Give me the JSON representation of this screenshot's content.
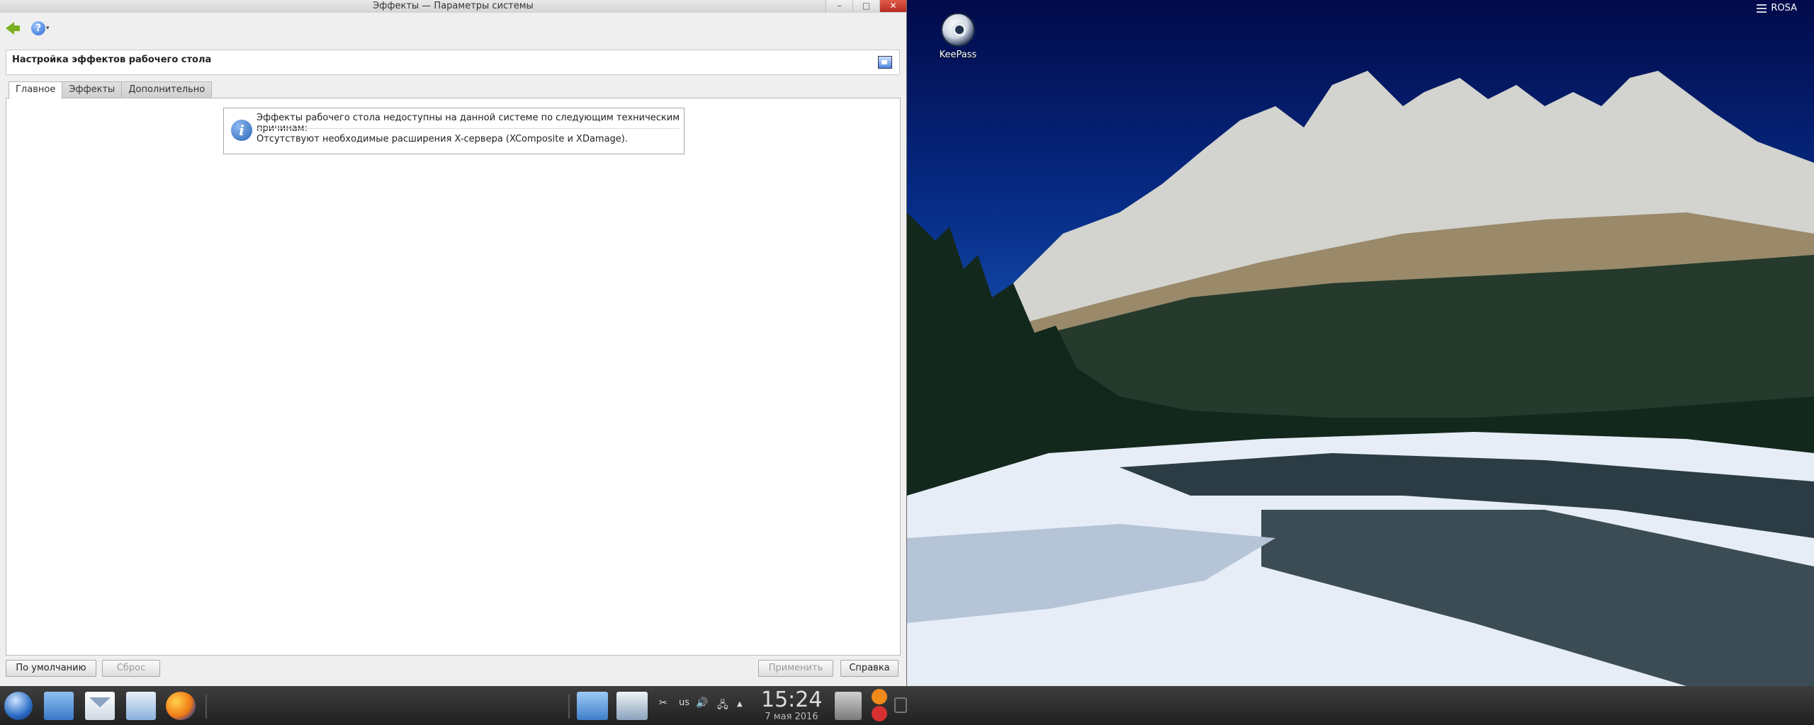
{
  "window": {
    "title": "Эффекты — Параметры системы",
    "controls": {
      "minimize": "–",
      "maximize": "□",
      "close": "✕"
    }
  },
  "toolbar": {
    "help_arrow": "▾"
  },
  "header": {
    "title": "Настройка эффектов рабочего стола"
  },
  "tabs": [
    {
      "label": "Главное",
      "active": true
    },
    {
      "label": "Эффекты",
      "active": false
    },
    {
      "label": "Дополнительно",
      "active": false
    }
  ],
  "info": {
    "icon_glyph": "i",
    "line1": "Эффекты рабочего стола недоступны на данной системе по следующим техническим причинам:",
    "line2": "Отсутствуют необходимые расширения X-сервера (XComposite и XDamage)."
  },
  "buttons": {
    "defaults": "По умолчанию",
    "reset": "Сброс",
    "apply": "Применить",
    "help": "Справка"
  },
  "desktop": {
    "icon_label": "KeePass",
    "top_right_label": "ROSA"
  },
  "taskbar": {
    "keyboard_layout": "us",
    "clock_time": "15:24",
    "clock_date": "7 мая 2016",
    "tray_arrow": "▲"
  }
}
